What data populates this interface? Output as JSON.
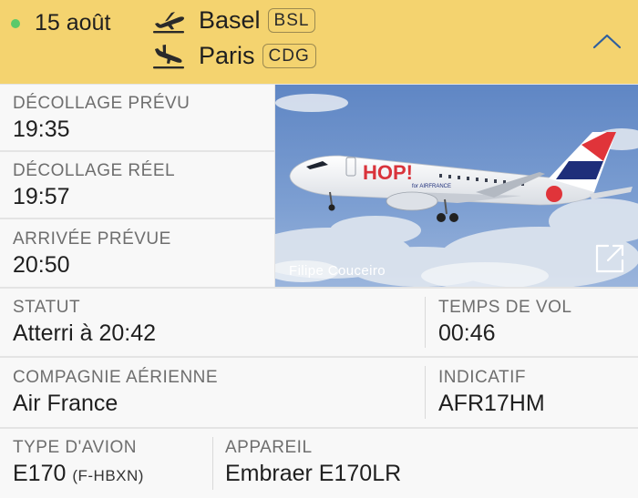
{
  "header": {
    "date": "15 août",
    "departure_city": "Basel",
    "departure_code": "BSL",
    "arrival_city": "Paris",
    "arrival_code": "CDG",
    "status_dot_color": "#5cc96a",
    "background_color": "#f4d36f",
    "icons": {
      "departure": "takeoff-icon",
      "arrival": "landing-icon",
      "collapse": "chevron-up-icon"
    }
  },
  "times": {
    "scheduled_departure_label": "DÉCOLLAGE PRÉVU",
    "scheduled_departure": "19:35",
    "actual_departure_label": "DÉCOLLAGE RÉEL",
    "actual_departure": "19:57",
    "scheduled_arrival_label": "ARRIVÉE PRÉVUE",
    "scheduled_arrival": "20:50"
  },
  "photo": {
    "credit": "Filipe Couceiro",
    "livery_text": "HOP!",
    "livery_subtext": "for AIRFRANCE",
    "open_icon": "external-link-icon"
  },
  "details": {
    "status_label": "STATUT",
    "status": "Atterri à 20:42",
    "flight_time_label": "TEMPS DE VOL",
    "flight_time": "00:46",
    "airline_label": "COMPAGNIE AÉRIENNE",
    "airline": "Air France",
    "callsign_label": "INDICATIF",
    "callsign": "AFR17HM",
    "aircraft_type_label": "TYPE D'AVION",
    "aircraft_type": "E170",
    "registration": "(F-HBXN)",
    "aircraft_label": "APPAREIL",
    "aircraft": "Embraer E170LR"
  }
}
